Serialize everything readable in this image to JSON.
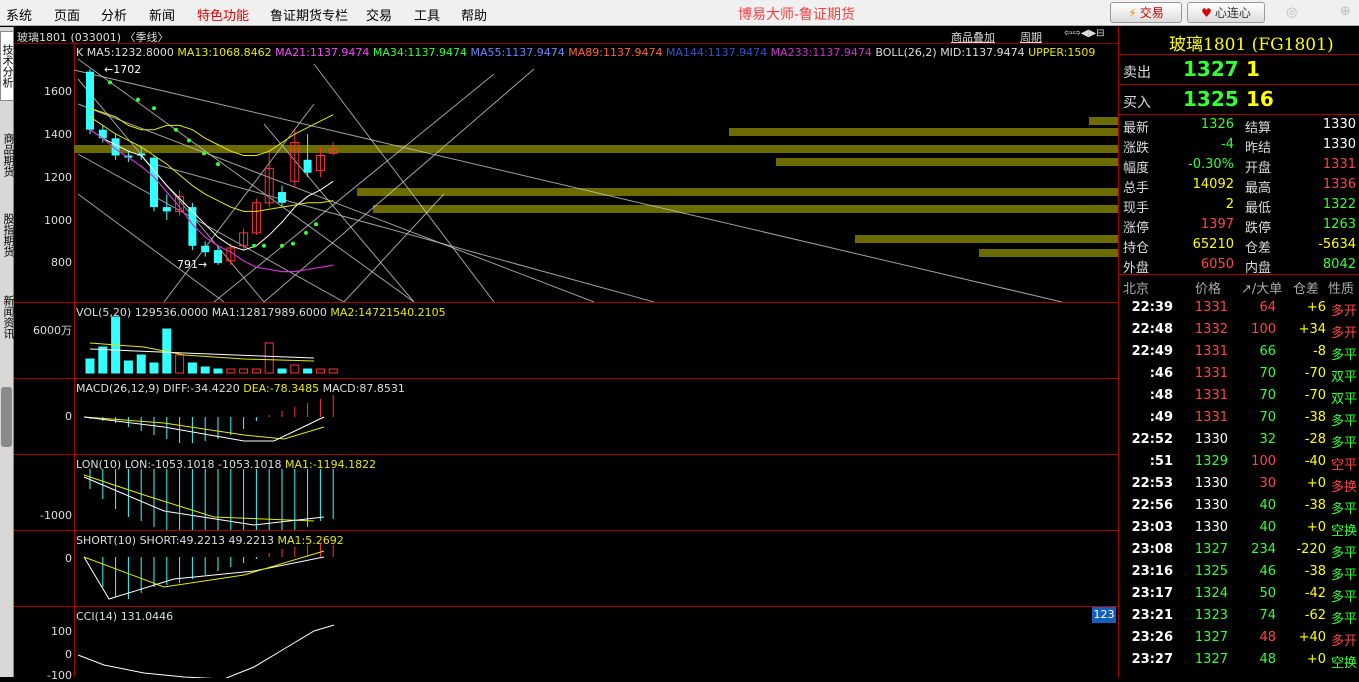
{
  "menu": {
    "items": [
      "系统",
      "页面",
      "分析",
      "新闻",
      "特色功能",
      "鲁证期货专栏",
      "交易",
      "工具",
      "帮助"
    ],
    "app_title": "博易大师-鲁证期货",
    "trade_button": "交易",
    "heart_button": "心连心"
  },
  "left_tabs": [
    "技术分析",
    "商品期货",
    "股指期货",
    "新闻资讯"
  ],
  "chart": {
    "symbol_title": "玻璃1801 (033001) 〈季线〉",
    "ma_line": [
      {
        "text": "K",
        "color": "#dddddd"
      },
      {
        "text": "MA5:1232.8000",
        "color": "#dddddd"
      },
      {
        "text": "MA13:1068.8462",
        "color": "#e8e800"
      },
      {
        "text": "MA21:1137.9474",
        "color": "#ff44ff"
      },
      {
        "text": "MA34:1137.9474",
        "color": "#33ff33"
      },
      {
        "text": "MA55:1137.9474",
        "color": "#6688ff"
      },
      {
        "text": "MA89:1137.9474",
        "color": "#ff6633"
      },
      {
        "text": "MA144:1137.9474",
        "color": "#3355cc"
      },
      {
        "text": "MA233:1137.9474",
        "color": "#cc33cc"
      },
      {
        "text": "BOLL(26,2)",
        "color": "#dddddd"
      },
      {
        "text": "MID:1137.9474",
        "color": "#dddddd"
      },
      {
        "text": "UPPER:1509",
        "color": "#e8e800"
      }
    ],
    "high_label": "1702",
    "low_label": "791",
    "price_ticks": [
      "1600",
      "1400",
      "1200",
      "1000",
      "800"
    ],
    "overlay_buttons": [
      "商品叠加",
      "周期"
    ],
    "vol": {
      "header": "VOL(5,20)",
      "v1": "129536.0000",
      "ma1": "MA1:12817989.6000",
      "ma2": "MA2:14721540.2105",
      "tick": "6000万"
    },
    "macd": {
      "header": "MACD(26,12,9)",
      "diff": "DIFF:-34.4220",
      "dea": "DEA:-78.3485",
      "macd": "MACD:87.8531",
      "tick": "0"
    },
    "lon": {
      "header": "LON(10)",
      "lon": "LON:-1053.1018",
      "v2": "-1053.1018",
      "ma1": "MA1:-1194.1822",
      "tick": "-1000"
    },
    "short": {
      "header": "SHORT(10)",
      "short": "SHORT:49.2213",
      "v2": "49.2213",
      "ma1": "MA1:5.2692",
      "tick": "0"
    },
    "cci": {
      "header": "CCI(14)",
      "value": "131.0446",
      "ticks": [
        "100",
        "0",
        "-100"
      ],
      "badge": "123"
    }
  },
  "quote": {
    "title": "玻璃1801 (FG1801)",
    "sell": {
      "label": "卖出",
      "price": "1327",
      "vol": "1"
    },
    "buy": {
      "label": "买入",
      "price": "1325",
      "vol": "16"
    },
    "rows": [
      {
        "l1": "最新",
        "v1": "1326",
        "c1": "#33ff33",
        "l2": "结算",
        "v2": "1330",
        "c2": "#ffffff"
      },
      {
        "l1": "涨跌",
        "v1": "-4",
        "c1": "#33ff33",
        "l2": "昨结",
        "v2": "1330",
        "c2": "#ffffff"
      },
      {
        "l1": "幅度",
        "v1": "-0.30%",
        "c1": "#33ff33",
        "l2": "开盘",
        "v2": "1331",
        "c2": "#ff4444"
      },
      {
        "l1": "总手",
        "v1": "14092",
        "c1": "#ffff00",
        "l2": "最高",
        "v2": "1336",
        "c2": "#ff4444"
      },
      {
        "l1": "现手",
        "v1": "2",
        "c1": "#ffff00",
        "l2": "最低",
        "v2": "1322",
        "c2": "#33ff33"
      },
      {
        "l1": "涨停",
        "v1": "1397",
        "c1": "#ff4444",
        "l2": "跌停",
        "v2": "1263",
        "c2": "#33ff33"
      },
      {
        "l1": "持仓",
        "v1": "65210",
        "c1": "#ffff00",
        "l2": "仓差",
        "v2": "-5634",
        "c2": "#ffff00"
      },
      {
        "l1": "外盘",
        "v1": "6050",
        "c1": "#ff4444",
        "l2": "内盘",
        "v2": "8042",
        "c2": "#33ff33"
      }
    ],
    "trades_header": [
      "北京",
      "价格",
      "↗/大单",
      "仓差",
      "性质"
    ],
    "trades": [
      {
        "t": "22:39",
        "p": "1331",
        "pc": "#ff4444",
        "v": "64",
        "vc": "#ff4444",
        "d": "+6",
        "dc": "#ffff00",
        "n": "多开",
        "nc": "#ff4444"
      },
      {
        "t": "22:48",
        "p": "1332",
        "pc": "#ff4444",
        "v": "100",
        "vc": "#ff4444",
        "d": "+34",
        "dc": "#ffff00",
        "n": "多开",
        "nc": "#ff4444"
      },
      {
        "t": "22:49",
        "p": "1331",
        "pc": "#ff4444",
        "v": "66",
        "vc": "#33ff33",
        "d": "-8",
        "dc": "#ffff00",
        "n": "多平",
        "nc": "#33ff33"
      },
      {
        "t": ":46",
        "p": "1331",
        "pc": "#ff4444",
        "v": "70",
        "vc": "#33ff33",
        "d": "-70",
        "dc": "#ffff00",
        "n": "双平",
        "nc": "#33ff33"
      },
      {
        "t": ":48",
        "p": "1331",
        "pc": "#ff4444",
        "v": "70",
        "vc": "#33ff33",
        "d": "-70",
        "dc": "#ffff00",
        "n": "双平",
        "nc": "#33ff33"
      },
      {
        "t": ":49",
        "p": "1331",
        "pc": "#ff4444",
        "v": "70",
        "vc": "#33ff33",
        "d": "-38",
        "dc": "#ffff00",
        "n": "多平",
        "nc": "#33ff33"
      },
      {
        "t": "22:52",
        "p": "1330",
        "pc": "#ffffff",
        "v": "32",
        "vc": "#33ff33",
        "d": "-28",
        "dc": "#ffff00",
        "n": "多平",
        "nc": "#33ff33"
      },
      {
        "t": ":51",
        "p": "1329",
        "pc": "#33ff33",
        "v": "100",
        "vc": "#ff4444",
        "d": "-40",
        "dc": "#ffff00",
        "n": "空平",
        "nc": "#ff4444"
      },
      {
        "t": "22:53",
        "p": "1330",
        "pc": "#ffffff",
        "v": "30",
        "vc": "#ff4444",
        "d": "+0",
        "dc": "#ffff00",
        "n": "多换",
        "nc": "#ff4444"
      },
      {
        "t": "22:56",
        "p": "1330",
        "pc": "#ffffff",
        "v": "40",
        "vc": "#33ff33",
        "d": "-38",
        "dc": "#ffff00",
        "n": "多平",
        "nc": "#33ff33"
      },
      {
        "t": "23:03",
        "p": "1330",
        "pc": "#ffffff",
        "v": "40",
        "vc": "#33ff33",
        "d": "+0",
        "dc": "#ffff00",
        "n": "空换",
        "nc": "#33ff33"
      },
      {
        "t": "23:08",
        "p": "1327",
        "pc": "#33ff33",
        "v": "234",
        "vc": "#33ff33",
        "d": "-220",
        "dc": "#ffff00",
        "n": "多平",
        "nc": "#33ff33"
      },
      {
        "t": "23:16",
        "p": "1325",
        "pc": "#33ff33",
        "v": "46",
        "vc": "#33ff33",
        "d": "-38",
        "dc": "#ffff00",
        "n": "多平",
        "nc": "#33ff33"
      },
      {
        "t": "23:17",
        "p": "1324",
        "pc": "#33ff33",
        "v": "50",
        "vc": "#33ff33",
        "d": "-42",
        "dc": "#ffff00",
        "n": "多平",
        "nc": "#33ff33"
      },
      {
        "t": "23:21",
        "p": "1323",
        "pc": "#33ff33",
        "v": "74",
        "vc": "#33ff33",
        "d": "-62",
        "dc": "#ffff00",
        "n": "多平",
        "nc": "#33ff33"
      },
      {
        "t": "23:26",
        "p": "1327",
        "pc": "#33ff33",
        "v": "48",
        "vc": "#ff4444",
        "d": "+40",
        "dc": "#ffff00",
        "n": "多开",
        "nc": "#ff4444"
      },
      {
        "t": "23:27",
        "p": "1327",
        "pc": "#33ff33",
        "v": "48",
        "vc": "#33ff33",
        "d": "+0",
        "dc": "#ffff00",
        "n": "空换",
        "nc": "#33ff33"
      }
    ]
  },
  "chart_data": {
    "type": "candlestick",
    "price_axis_ticks": [
      1600,
      1400,
      1200,
      1000,
      800
    ],
    "candles": [
      {
        "o": 1690,
        "c": 1420,
        "h": 1702,
        "l": 1400,
        "up": false
      },
      {
        "o": 1420,
        "c": 1380,
        "h": 1440,
        "l": 1360,
        "up": false
      },
      {
        "o": 1380,
        "c": 1300,
        "h": 1400,
        "l": 1280,
        "up": false
      },
      {
        "o": 1300,
        "c": 1290,
        "h": 1320,
        "l": 1270,
        "up": false
      },
      {
        "o": 1310,
        "c": 1300,
        "h": 1340,
        "l": 1280,
        "up": false
      },
      {
        "o": 1290,
        "c": 1060,
        "h": 1300,
        "l": 1040,
        "up": false
      },
      {
        "o": 1060,
        "c": 1040,
        "h": 1120,
        "l": 1000,
        "up": false
      },
      {
        "o": 1040,
        "c": 1110,
        "h": 1140,
        "l": 1020,
        "up": true
      },
      {
        "o": 1060,
        "c": 880,
        "h": 1080,
        "l": 860,
        "up": false
      },
      {
        "o": 880,
        "c": 850,
        "h": 900,
        "l": 830,
        "up": false
      },
      {
        "o": 860,
        "c": 800,
        "h": 880,
        "l": 791,
        "up": false
      },
      {
        "o": 810,
        "c": 870,
        "h": 890,
        "l": 791,
        "up": true
      },
      {
        "o": 880,
        "c": 940,
        "h": 960,
        "l": 860,
        "up": true
      },
      {
        "o": 940,
        "c": 1080,
        "h": 1100,
        "l": 930,
        "up": true
      },
      {
        "o": 1080,
        "c": 1240,
        "h": 1330,
        "l": 1060,
        "up": true
      },
      {
        "o": 1130,
        "c": 1080,
        "h": 1160,
        "l": 1060,
        "up": false
      },
      {
        "o": 1180,
        "c": 1360,
        "h": 1420,
        "l": 1150,
        "up": true
      },
      {
        "o": 1280,
        "c": 1220,
        "h": 1400,
        "l": 1200,
        "up": false
      },
      {
        "o": 1230,
        "c": 1300,
        "h": 1340,
        "l": 1200,
        "up": true
      },
      {
        "o": 1310,
        "c": 1330,
        "h": 1360,
        "l": 1300,
        "up": true
      }
    ],
    "volume_axis_tick": "6000万"
  }
}
